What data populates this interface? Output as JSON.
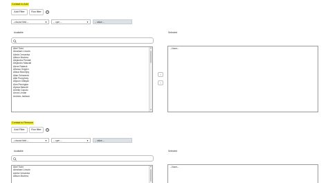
{
  "sections": [
    {
      "title": "Contact to Add",
      "add_filter_label": "Add Filter",
      "run_filter_label": "Run filter",
      "help_glyph": "?",
      "field_select": "--choose field --",
      "oper_select": "-- oper --",
      "value_select": "-- value --",
      "available_label": "Available",
      "selected_label": "Selected",
      "available_items": [
        "Abel Tuter",
        "Abraham Lincoln",
        "Adela Cervantsz",
        "Allison Mortera",
        "Alejandra Prenatt",
        "Alejandro Mascall",
        "Alene Rabeck",
        "Alfonso Griglen",
        "Alissa Mountjoy",
        "Allan Schwantd",
        "Allie Pumphrey",
        "Allyson Gillispie",
        "Alva Pennigton",
        "Alyssa Biasotti",
        "Amelia Caputo",
        "Amos Linnan",
        "Andrew Jackson"
      ],
      "selected_none": "--None--"
    },
    {
      "title": "Contact to Remove",
      "add_filter_label": "Add Filter",
      "run_filter_label": "Run filter",
      "help_glyph": "?",
      "field_select": "--choose field --",
      "oper_select": "-- oper --",
      "value_select": "-- value --",
      "available_label": "Available",
      "selected_label": "Selected",
      "available_items": [
        "Abel Tuter",
        "Abraham Lincoln",
        "Adela Cervantsz",
        "Allison Mortera"
      ],
      "selected_none": "--None--"
    }
  ],
  "move_right_glyph": "›",
  "move_left_glyph": "‹",
  "colors": {
    "highlight": "#f7f230",
    "disabled_select": "#dde2e6"
  }
}
